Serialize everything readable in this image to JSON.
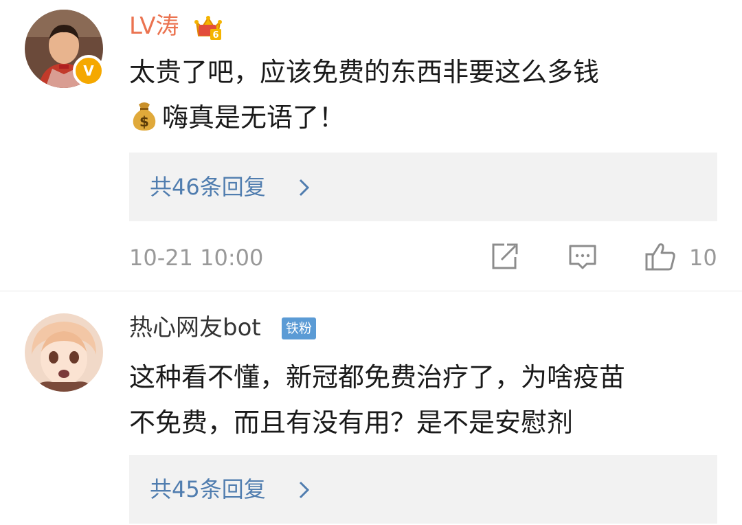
{
  "comments": [
    {
      "username": "LV涛",
      "user_color": "#eb7350",
      "badge_icon": "crown-vip-badge",
      "avatar_badge": "V",
      "text_line1": "太贵了吧，应该免费的东西非要这么多钱",
      "text_line2": "嗨真是无语了！",
      "inline_emoji": "money-bag-emoji",
      "reply_summary": "共46条回复",
      "timestamp": "10-21 10:00",
      "like_count": "10"
    },
    {
      "username": "热心网友bot",
      "user_color": "#333333",
      "fan_badge": "铁粉",
      "text_line1": "这种看不懂，新冠都免费治疗了，为啥疫苗",
      "text_line2": "不免费，而且有没有用？是不是安慰剂",
      "reply_summary": "共45条回复"
    }
  ],
  "colors": {
    "reply_link": "#507daf",
    "meta_gray": "#999999",
    "reply_bg": "#f2f2f2",
    "fan_badge_bg": "#5b9bd5"
  }
}
